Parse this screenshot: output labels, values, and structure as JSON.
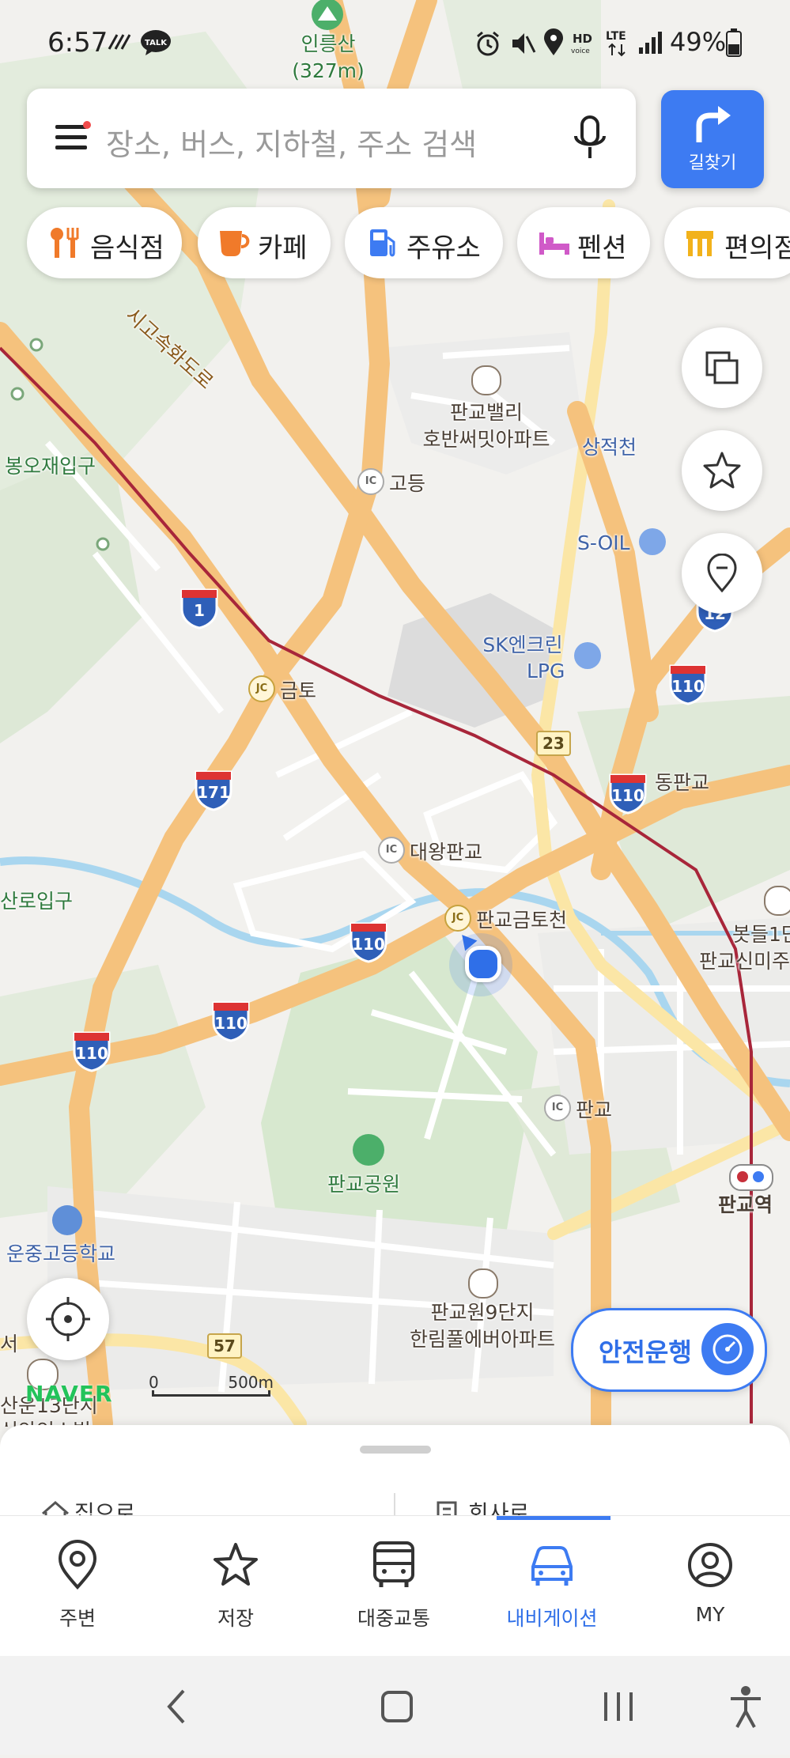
{
  "status_bar": {
    "time": "6:57",
    "battery": "49%",
    "icons": [
      "missed-call-icon",
      "kakaotalk-icon",
      "alarm-icon",
      "mute-icon",
      "location-icon",
      "hd-voice-icon",
      "lte-icon",
      "signal-icon",
      "battery-icon"
    ]
  },
  "search": {
    "placeholder": "장소, 버스, 지하철, 주소 검색",
    "route_button_label": "길찾기"
  },
  "categories": [
    {
      "label": "음식점",
      "icon": "restaurant-icon",
      "color": "#f07a2a"
    },
    {
      "label": "카페",
      "icon": "cafe-icon",
      "color": "#f07a2a"
    },
    {
      "label": "주유소",
      "icon": "gas-station-icon",
      "color": "#3d7bf2"
    },
    {
      "label": "펜션",
      "icon": "bed-icon",
      "color": "#d05ac8"
    },
    {
      "label": "편의점",
      "icon": "convenience-store-icon",
      "color": "#f2b21b"
    }
  ],
  "map": {
    "peak_name": "인릉산",
    "peak_height": "(327m)",
    "labels": {
      "expressway": "시고속화도로",
      "apt1_line1": "판교밸리",
      "apt1_line2": "호반써밋아파트",
      "stream1": "상적천",
      "bongo": "봉오재입구",
      "ic_godeung": "고등",
      "soil": "S-OIL",
      "sk_line1": "SK엔크린",
      "sk_line2": "LPG",
      "jc_geumto": "금토",
      "ic_dongpangyo": "동판교",
      "ic_daewang": "대왕판교",
      "sanro": "산로입구",
      "jc_pangyo": "판교금토천",
      "bot_line1": "봇들1단",
      "bot_line2": "판교신미주",
      "ic_pangyo": "판교",
      "park": "판교공원",
      "station": "판교역",
      "school": "운중고등학교",
      "apt2_line1": "판교원9단지",
      "apt2_line2": "한림풀에버아파트",
      "seo": "서",
      "unjung_line1": "산운13단지",
      "unjung_line2": "신안인스빌"
    },
    "shields": {
      "s1": "1",
      "s171": "171",
      "s110": "110",
      "s12": "12"
    },
    "route_23": "23",
    "route_57": "57",
    "ic_text": "IC",
    "jc_text": "JC",
    "scale_zero": "0",
    "scale_length": "500m",
    "brand": "NAVER"
  },
  "side_controls": [
    "layers-icon",
    "star-icon",
    "pin-icon"
  ],
  "safe_drive_label": "안전운행",
  "bottom_sheet": {
    "left_peek": "집으로",
    "right_peek": "회사로"
  },
  "bottom_nav": [
    {
      "label": "주변",
      "icon": "location-pin-icon",
      "active": false
    },
    {
      "label": "저장",
      "icon": "star-icon",
      "active": false
    },
    {
      "label": "대중교통",
      "icon": "bus-icon",
      "active": false
    },
    {
      "label": "내비게이션",
      "icon": "car-icon",
      "active": true
    },
    {
      "label": "MY",
      "icon": "user-icon",
      "active": false
    }
  ],
  "colors": {
    "accent": "#3d7bf2",
    "road_major": "#f5c27d",
    "road_secondary": "#fbe6a6",
    "subway_line": "#a8263a",
    "water": "#a9d6ef",
    "park": "#d7e8cf"
  }
}
